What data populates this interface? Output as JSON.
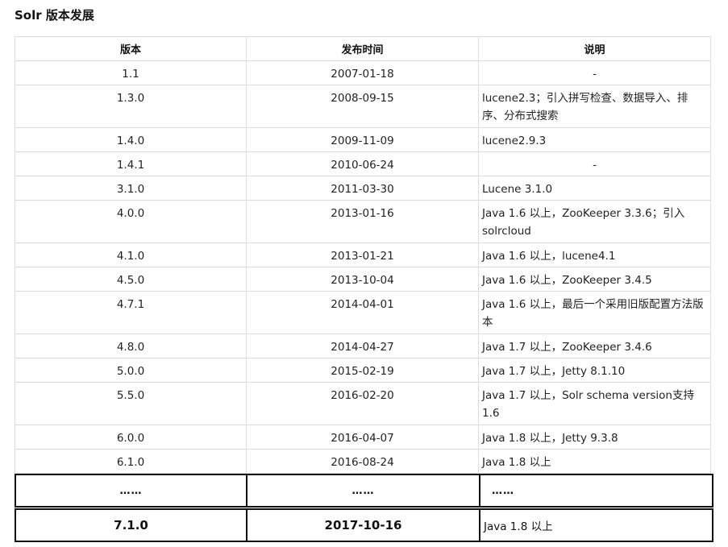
{
  "title": "Solr 版本发展",
  "headers": [
    "版本",
    "发布时间",
    "说明"
  ],
  "rows": [
    {
      "version": "1.1",
      "date": "2007-01-18",
      "desc": "-"
    },
    {
      "version": "1.3.0",
      "date": "2008-09-15",
      "desc": "lucene2.3；引入拼写检查、数据导入、排序、分布式搜索"
    },
    {
      "version": "1.4.0",
      "date": "2009-11-09",
      "desc": "lucene2.9.3"
    },
    {
      "version": "1.4.1",
      "date": "2010-06-24",
      "desc": "-"
    },
    {
      "version": "3.1.0",
      "date": "2011-03-30",
      "desc": "Lucene 3.1.0"
    },
    {
      "version": "4.0.0",
      "date": "2013-01-16",
      "desc": "Java 1.6 以上，ZooKeeper 3.3.6；引入solrcloud"
    },
    {
      "version": "4.1.0",
      "date": "2013-01-21",
      "desc": "Java 1.6 以上，lucene4.1"
    },
    {
      "version": "4.5.0",
      "date": "2013-10-04",
      "desc": "Java 1.6 以上，ZooKeeper 3.4.5"
    },
    {
      "version": "4.7.1",
      "date": "2014-04-01",
      "desc": "Java 1.6 以上，最后一个采用旧版配置方法版本"
    },
    {
      "version": "4.8.0",
      "date": "2014-04-27",
      "desc": "Java 1.7 以上，ZooKeeper 3.4.6"
    },
    {
      "version": "5.0.0",
      "date": "2015-02-19",
      "desc": "Java 1.7 以上，Jetty 8.1.10"
    },
    {
      "version": "5.5.0",
      "date": "2016-02-20",
      "desc": "Java 1.7 以上，Solr schema version支持1.6"
    },
    {
      "version": "6.0.0",
      "date": "2016-04-07",
      "desc": "Java 1.8 以上，Jetty 9.3.8"
    },
    {
      "version": "6.1.0",
      "date": "2016-08-24",
      "desc": "Java 1.8 以上"
    }
  ],
  "ellipsis_row": {
    "version": "……",
    "date": "……",
    "desc": "……"
  },
  "latest_row": {
    "version": "7.1.0",
    "date": "2017-10-16",
    "desc": "Java 1.8 以上"
  }
}
